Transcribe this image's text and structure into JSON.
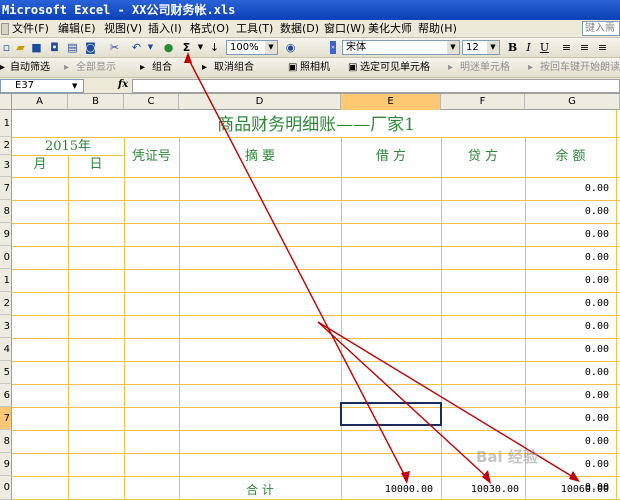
{
  "window": {
    "title": "Microsoft Excel - XX公司财务帐.xls"
  },
  "menubar": {
    "items": [
      "文件(F)",
      "编辑(E)",
      "视图(V)",
      "插入(I)",
      "格式(O)",
      "工具(T)",
      "数据(D)",
      "窗口(W)",
      "美化大师",
      "帮助(H)"
    ],
    "help_placeholder": "键入需"
  },
  "toolbar": {
    "zoom": "100%",
    "font_name": "宋体",
    "font_size": "12",
    "sum_symbol": "Σ",
    "bold_label": "B",
    "italic_label": "I",
    "underline_label": "U"
  },
  "toolbar2": {
    "items": [
      "自动筛选",
      "全部显示",
      "组合",
      "取消组合",
      "照相机",
      "选定可见单元格",
      "明迷单元格",
      "按回车键开始朗读"
    ]
  },
  "formula_bar": {
    "name_box": "E37",
    "fx_label": "fx",
    "formula": ""
  },
  "columns": [
    "A",
    "B",
    "C",
    "D",
    "E",
    "F",
    "G"
  ],
  "selected_column": "E",
  "row_numbers": [
    "1",
    "2",
    "3",
    "7",
    "8",
    "9",
    "0",
    "1",
    "2",
    "3",
    "4",
    "5",
    "6",
    "7",
    "8",
    "9",
    "0"
  ],
  "selected_row_index": 13,
  "sheet": {
    "title": "商品财务明细账——厂家1",
    "year_header": "2015年",
    "month_header": "月",
    "day_header": "日",
    "voucher_header": "凭证号",
    "summary_header": "摘 要",
    "debit_header": "借 方",
    "credit_header": "贷 方",
    "balance_header": "余 额",
    "balance_values": [
      "0.00",
      "0.00",
      "0.00",
      "0.00",
      "0.00",
      "0.00",
      "0.00",
      "0.00",
      "0.00",
      "0.00",
      "0.00",
      "0.00",
      "0.00",
      "0.00"
    ],
    "total_label": "合 计",
    "total_debit": "10000.00",
    "total_credit": "10030.00",
    "total_balance": "10060.00"
  },
  "watermark": "Bai 经验",
  "colors": {
    "accent": "#c00000",
    "header_text": "#2a8a36",
    "grid": "#f0c24a",
    "titlebar": "#0b3fb5"
  }
}
